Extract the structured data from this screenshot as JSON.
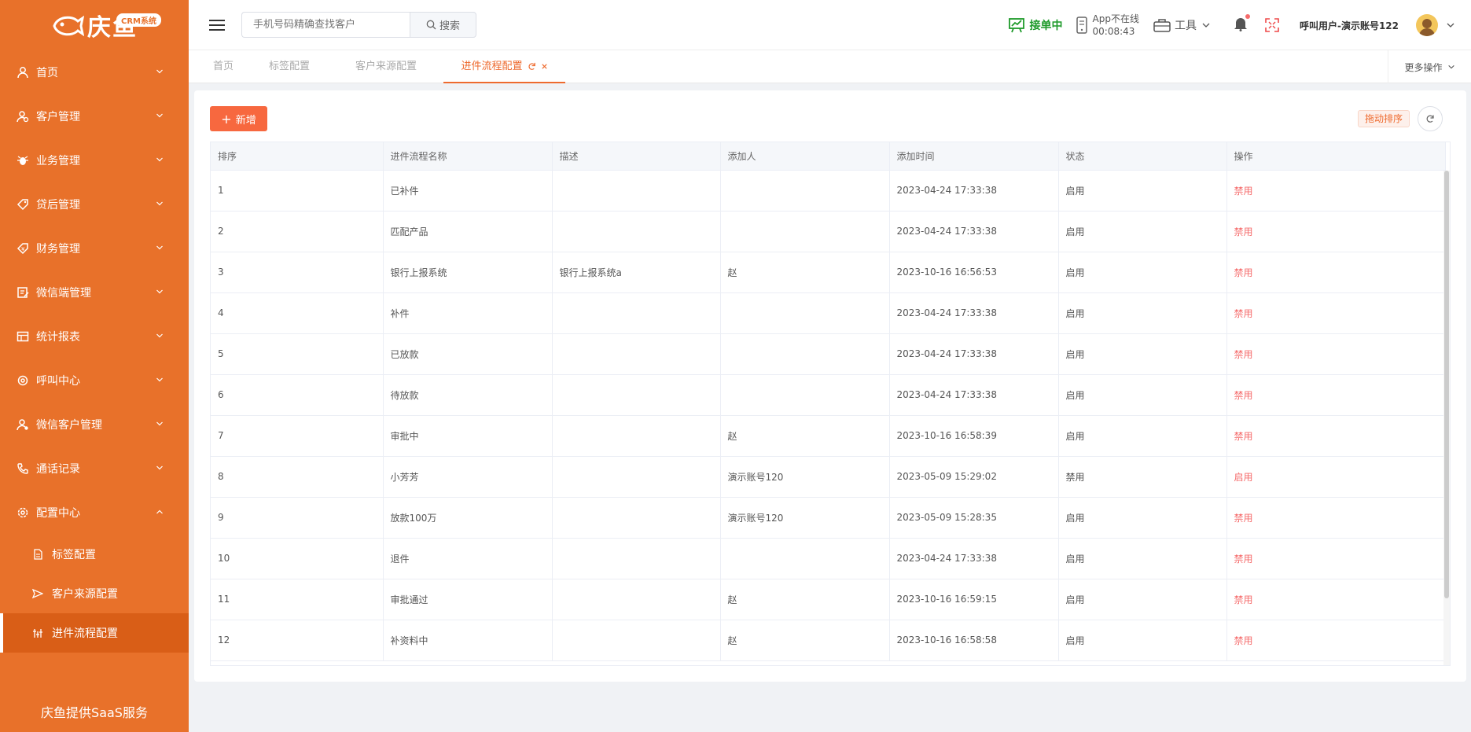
{
  "app": {
    "logo_text": "庆鱼",
    "logo_badge": "CRM系统",
    "footer": "庆鱼提供SaaS服务"
  },
  "sidebar": {
    "items": [
      {
        "label": "首页",
        "icon": "user-icon",
        "expanded": false
      },
      {
        "label": "客户管理",
        "icon": "customer-icon",
        "expanded": false
      },
      {
        "label": "业务管理",
        "icon": "bug-icon",
        "expanded": false
      },
      {
        "label": "贷后管理",
        "icon": "tag-icon",
        "expanded": false
      },
      {
        "label": "财务管理",
        "icon": "money-icon",
        "expanded": false
      },
      {
        "label": "微信端管理",
        "icon": "edit-icon",
        "expanded": false
      },
      {
        "label": "统计报表",
        "icon": "table-icon",
        "expanded": false
      },
      {
        "label": "呼叫中心",
        "icon": "gear-icon",
        "expanded": false
      },
      {
        "label": "微信客户管理",
        "icon": "wechat-user-icon",
        "expanded": false
      },
      {
        "label": "通话记录",
        "icon": "phone-icon",
        "expanded": false
      },
      {
        "label": "配置中心",
        "icon": "settings-icon",
        "expanded": true
      }
    ],
    "sub_items": [
      {
        "label": "标签配置",
        "icon": "document-icon",
        "active": false
      },
      {
        "label": "客户来源配置",
        "icon": "send-icon",
        "active": false
      },
      {
        "label": "进件流程配置",
        "icon": "flow-icon",
        "active": true
      }
    ]
  },
  "header": {
    "search_placeholder": "手机号码精确查找客户",
    "search_button": "搜索",
    "receiving": "接单中",
    "app_status_line1": "App不在线",
    "app_status_line2": "00:08:43",
    "tools": "工具",
    "user_name": "呼叫用户-演示账号122"
  },
  "tabs": {
    "items": [
      "首页",
      "标签配置",
      "客户来源配置",
      "进件流程配置"
    ],
    "active": "进件流程配置",
    "more": "更多操作"
  },
  "toolbar": {
    "add_label": "新增",
    "drag_sort": "拖动排序"
  },
  "table": {
    "columns": [
      "排序",
      "进件流程名称",
      "描述",
      "添加人",
      "添加时间",
      "状态",
      "操作"
    ],
    "rows": [
      [
        "1",
        "已补件",
        "",
        "",
        "2023-04-24 17:33:38",
        "启用",
        "禁用"
      ],
      [
        "2",
        "匹配产品",
        "",
        "",
        "2023-04-24 17:33:38",
        "启用",
        "禁用"
      ],
      [
        "3",
        "银行上报系统",
        "银行上报系统a",
        "赵",
        "2023-10-16 16:56:53",
        "启用",
        "禁用"
      ],
      [
        "4",
        "补件",
        "",
        "",
        "2023-04-24 17:33:38",
        "启用",
        "禁用"
      ],
      [
        "5",
        "已放款",
        "",
        "",
        "2023-04-24 17:33:38",
        "启用",
        "禁用"
      ],
      [
        "6",
        "待放款",
        "",
        "",
        "2023-04-24 17:33:38",
        "启用",
        "禁用"
      ],
      [
        "7",
        "审批中",
        "",
        "赵",
        "2023-10-16 16:58:39",
        "启用",
        "禁用"
      ],
      [
        "8",
        "小芳芳",
        "",
        "演示账号120",
        "2023-05-09 15:29:02",
        "禁用",
        "启用"
      ],
      [
        "9",
        "放款100万",
        "",
        "演示账号120",
        "2023-05-09 15:28:35",
        "启用",
        "禁用"
      ],
      [
        "10",
        "退件",
        "",
        "",
        "2023-04-24 17:33:38",
        "启用",
        "禁用"
      ],
      [
        "11",
        "审批通过",
        "",
        "赵",
        "2023-10-16 16:59:15",
        "启用",
        "禁用"
      ],
      [
        "12",
        "补资料中",
        "",
        "赵",
        "2023-10-16 16:58:58",
        "启用",
        "禁用"
      ]
    ]
  },
  "colors": {
    "sidebar": "#e8712a",
    "accent": "#ee6a2e",
    "add_button": "#f7683f",
    "receiving": "#1e9a2a",
    "danger": "#f56c6c"
  }
}
